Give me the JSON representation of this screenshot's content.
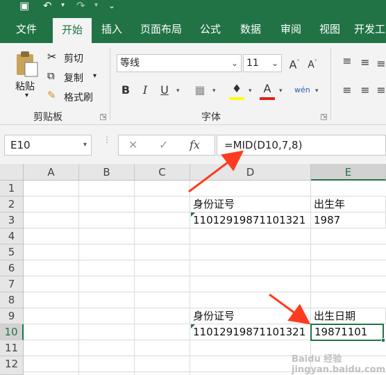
{
  "quick_access": {
    "icons": [
      "save-icon",
      "undo-icon",
      "redo-icon",
      "customize-icon"
    ]
  },
  "tabs": [
    {
      "label": "文件"
    },
    {
      "label": "开始"
    },
    {
      "label": "插入"
    },
    {
      "label": "页面布局"
    },
    {
      "label": "公式"
    },
    {
      "label": "数据"
    },
    {
      "label": "审阅"
    },
    {
      "label": "视图"
    },
    {
      "label": "开发工"
    }
  ],
  "active_tab": "开始",
  "ribbon": {
    "clipboard": {
      "paste": "粘贴",
      "cut": "剪切",
      "copy": "复制",
      "format_painter": "格式刷",
      "group_label": "剪贴板"
    },
    "font": {
      "font_name": "等线",
      "font_size": "11",
      "group_label": "字体"
    }
  },
  "name_box": "E10",
  "formula": "=MID(D10,7,8)",
  "columns": [
    "A",
    "B",
    "C",
    "D",
    "E"
  ],
  "selected_column": "E",
  "rows": [
    "1",
    "2",
    "3",
    "4",
    "5",
    "6",
    "7",
    "8",
    "9",
    "10",
    "11",
    "12"
  ],
  "selected_row": "10",
  "cells": {
    "D2": "身份证号",
    "E2": "出生年",
    "D3": "11012919871101321",
    "E3": "1987",
    "D9": "身份证号",
    "E9": "出生日期",
    "D10": "11012919871101321",
    "E10": "19871101"
  },
  "colors": {
    "accent": "#217346",
    "arrow": "#ff3b1f"
  },
  "watermark": "Baidu 经验 jingyan.baidu.com"
}
